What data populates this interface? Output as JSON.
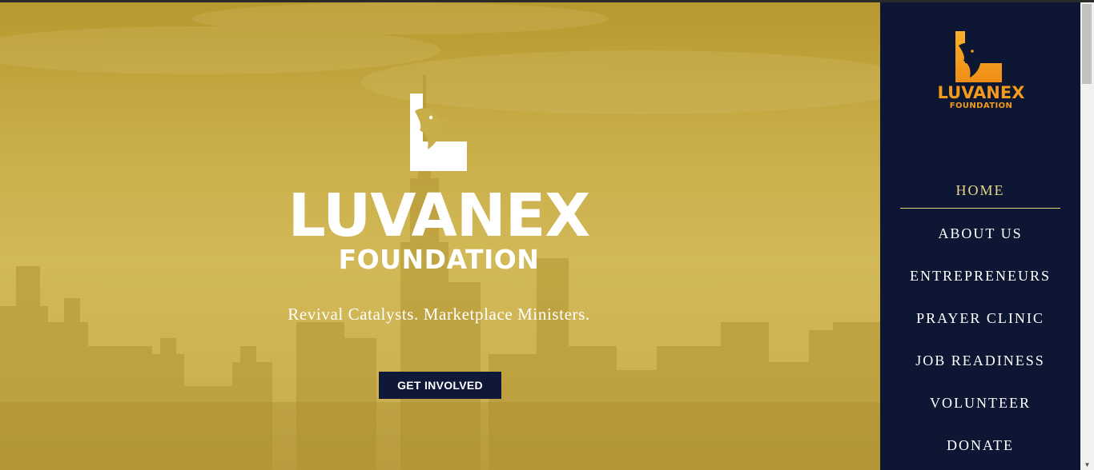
{
  "hero": {
    "brand_name": "LUVANEX",
    "brand_sub": "FOUNDATION",
    "tagline": "Revival Catalysts. Marketplace Ministers.",
    "cta_label": "GET INVOLVED"
  },
  "sidebar": {
    "logo_name": "LUVANEX",
    "logo_sub": "FOUNDATION",
    "nav": [
      {
        "label": "HOME"
      },
      {
        "label": "ABOUT US"
      },
      {
        "label": "ENTREPRENEURS"
      },
      {
        "label": "PRAYER CLINIC"
      },
      {
        "label": "JOB READINESS"
      },
      {
        "label": "VOLUNTEER"
      },
      {
        "label": "DONATE"
      }
    ]
  },
  "colors": {
    "hero_gold": "#c9ad48",
    "sidebar_navy": "#0d1733",
    "button_navy": "#0f1838",
    "logo_orange": "#f39a1a",
    "active_gold": "#ead38a"
  },
  "icons": {
    "hero_logo": "eagle-icon",
    "sidebar_logo": "eagle-icon",
    "scroll_arrow": "chevron-down-icon"
  }
}
